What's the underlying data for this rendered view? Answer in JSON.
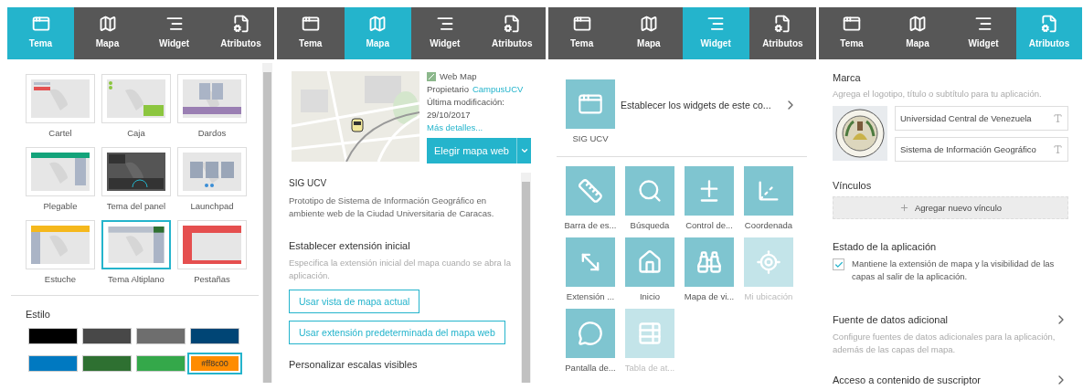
{
  "panels": [
    {
      "kind": "theme",
      "tabs": [
        {
          "label": "Tema",
          "selected": true
        },
        {
          "label": "Mapa",
          "selected": false
        },
        {
          "label": "Widget",
          "selected": false
        },
        {
          "label": "Atributos",
          "selected": false
        }
      ],
      "themes": [
        {
          "label": "Cartel",
          "selected": false
        },
        {
          "label": "Caja",
          "selected": false
        },
        {
          "label": "Dardos",
          "selected": false
        },
        {
          "label": "Plegable",
          "selected": false
        },
        {
          "label": "Tema del panel",
          "selected": false
        },
        {
          "label": "Launchpad",
          "selected": false
        },
        {
          "label": "Estuche",
          "selected": false
        },
        {
          "label": "Tema Altiplano",
          "selected": true
        },
        {
          "label": "Pestañas",
          "selected": false
        }
      ],
      "style_title": "Estilo",
      "swatches": [
        {
          "color": "#000000",
          "selected": false
        },
        {
          "color": "#484848",
          "selected": false
        },
        {
          "color": "#6e6e6e",
          "selected": false
        },
        {
          "color": "#004575",
          "selected": false
        },
        {
          "color": "#0079c1",
          "selected": false
        },
        {
          "color": "#2e7031",
          "selected": false
        },
        {
          "color": "#34a84a",
          "selected": false
        },
        {
          "color": "#ff8c00",
          "selected": true,
          "label": "#ff8c00"
        }
      ]
    },
    {
      "kind": "map",
      "tabs": [
        {
          "label": "Tema",
          "selected": false
        },
        {
          "label": "Mapa",
          "selected": true
        },
        {
          "label": "Widget",
          "selected": false
        },
        {
          "label": "Atributos",
          "selected": false
        }
      ],
      "item_type": "Web Map",
      "owner_label": "Propietario",
      "owner": "CampusUCV",
      "modified_label": "Última modificación:",
      "modified": "29/10/2017",
      "details_link": "Más detalles...",
      "choose_button": "Elegir mapa web",
      "title": "SIG UCV",
      "description": "Prototipo de Sistema de Información Geográfico en ambiente web de la Ciudad Universitaria de Caracas.",
      "extent": {
        "title": "Establecer extensión inicial",
        "hint": "Especifica la extensión inicial del mapa cuando se abra la aplicación.",
        "buttons": [
          "Usar vista de mapa actual",
          "Usar extensión predeterminada del mapa web"
        ]
      },
      "scales_title": "Personalizar escalas visibles"
    },
    {
      "kind": "widget",
      "tabs": [
        {
          "label": "Tema",
          "selected": false
        },
        {
          "label": "Mapa",
          "selected": false
        },
        {
          "label": "Widget",
          "selected": true
        },
        {
          "label": "Atributos",
          "selected": false
        }
      ],
      "header": {
        "label": "SIG UCV",
        "text": "Establecer los widgets de este co..."
      },
      "widgets": [
        {
          "label": "Barra de es...",
          "disabled": false
        },
        {
          "label": "Búsqueda",
          "disabled": false
        },
        {
          "label": "Control de...",
          "disabled": false
        },
        {
          "label": "Coordenada",
          "disabled": false
        },
        {
          "label": "Extensión ...",
          "disabled": false
        },
        {
          "label": "Inicio",
          "disabled": false
        },
        {
          "label": "Mapa de vi...",
          "disabled": false
        },
        {
          "label": "Mi ubicación",
          "disabled": true
        },
        {
          "label": "Pantalla de...",
          "disabled": false
        },
        {
          "label": "Tabla de at...",
          "disabled": true
        }
      ]
    },
    {
      "kind": "attributes",
      "tabs": [
        {
          "label": "Tema",
          "selected": false
        },
        {
          "label": "Mapa",
          "selected": false
        },
        {
          "label": "Widget",
          "selected": false
        },
        {
          "label": "Atributos",
          "selected": true
        }
      ],
      "brand": {
        "title": "Marca",
        "hint": "Agrega el logotipo, título o subtítulo para tu aplicación.",
        "fields": [
          "Universidad Central de Venezuela",
          "Sistema de Información Geográfico"
        ]
      },
      "links": {
        "title": "Vínculos",
        "button": "Agregar nuevo vínculo"
      },
      "app_state": {
        "title": "Estado de la aplicación",
        "checked": true,
        "text": "Mantiene la extensión de mapa y la visibilidad de las capas al salir de la aplicación."
      },
      "sections": [
        {
          "title": "Fuente de datos adicional",
          "hint": "Configure fuentes de datos adicionales para la aplicación, además de las capas del mapa."
        },
        {
          "title": "Acceso a contenido de suscriptor"
        }
      ]
    }
  ]
}
